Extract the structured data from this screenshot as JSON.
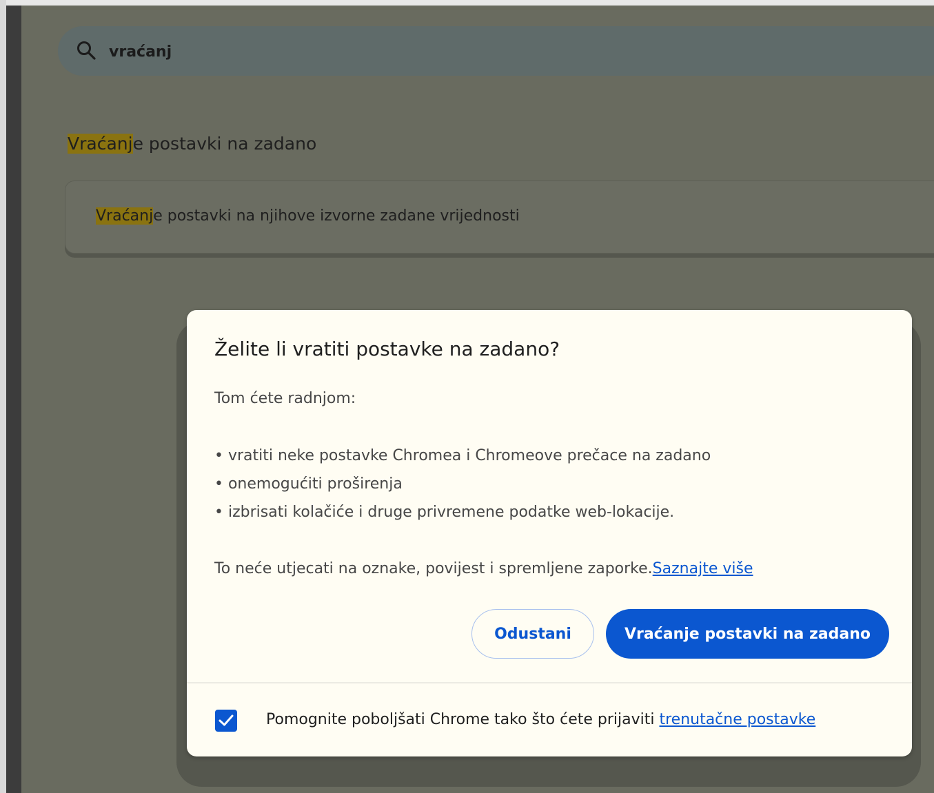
{
  "search": {
    "value": "vraćanj",
    "icon": "search-icon"
  },
  "section": {
    "title_match": "Vraćanj",
    "title_rest": "e postavki na zadano"
  },
  "reset_card": {
    "label_match": "Vraćanj",
    "label_rest": "e postavki na njihove izvorne zadane vrijednosti"
  },
  "dialog": {
    "title": "Želite li vratiti postavke na zadano?",
    "intro": "Tom ćete radnjom:",
    "bullets": [
      "• vratiti neke postavke Chromea i Chromeove prečace na zadano",
      "• onemogućiti proširenja",
      "• izbrisati kolačiće i druge privremene podatke web-lokacije."
    ],
    "note": "To neće utjecati na oznake, povijest i spremljene zaporke.",
    "learn_more": "Saznajte više",
    "cancel_label": "Odustani",
    "reset_label": "Vraćanje postavki na zadano",
    "report": {
      "checked": true,
      "label": "Pomognite poboljšati Chrome tako što ćete prijaviti ",
      "link": "trenutačne postavke"
    }
  },
  "colors": {
    "accent": "#0b57d0",
    "highlight": "#8a7310",
    "scrim_bg": "#696b5f",
    "dialog_bg": "#fffdf3"
  }
}
